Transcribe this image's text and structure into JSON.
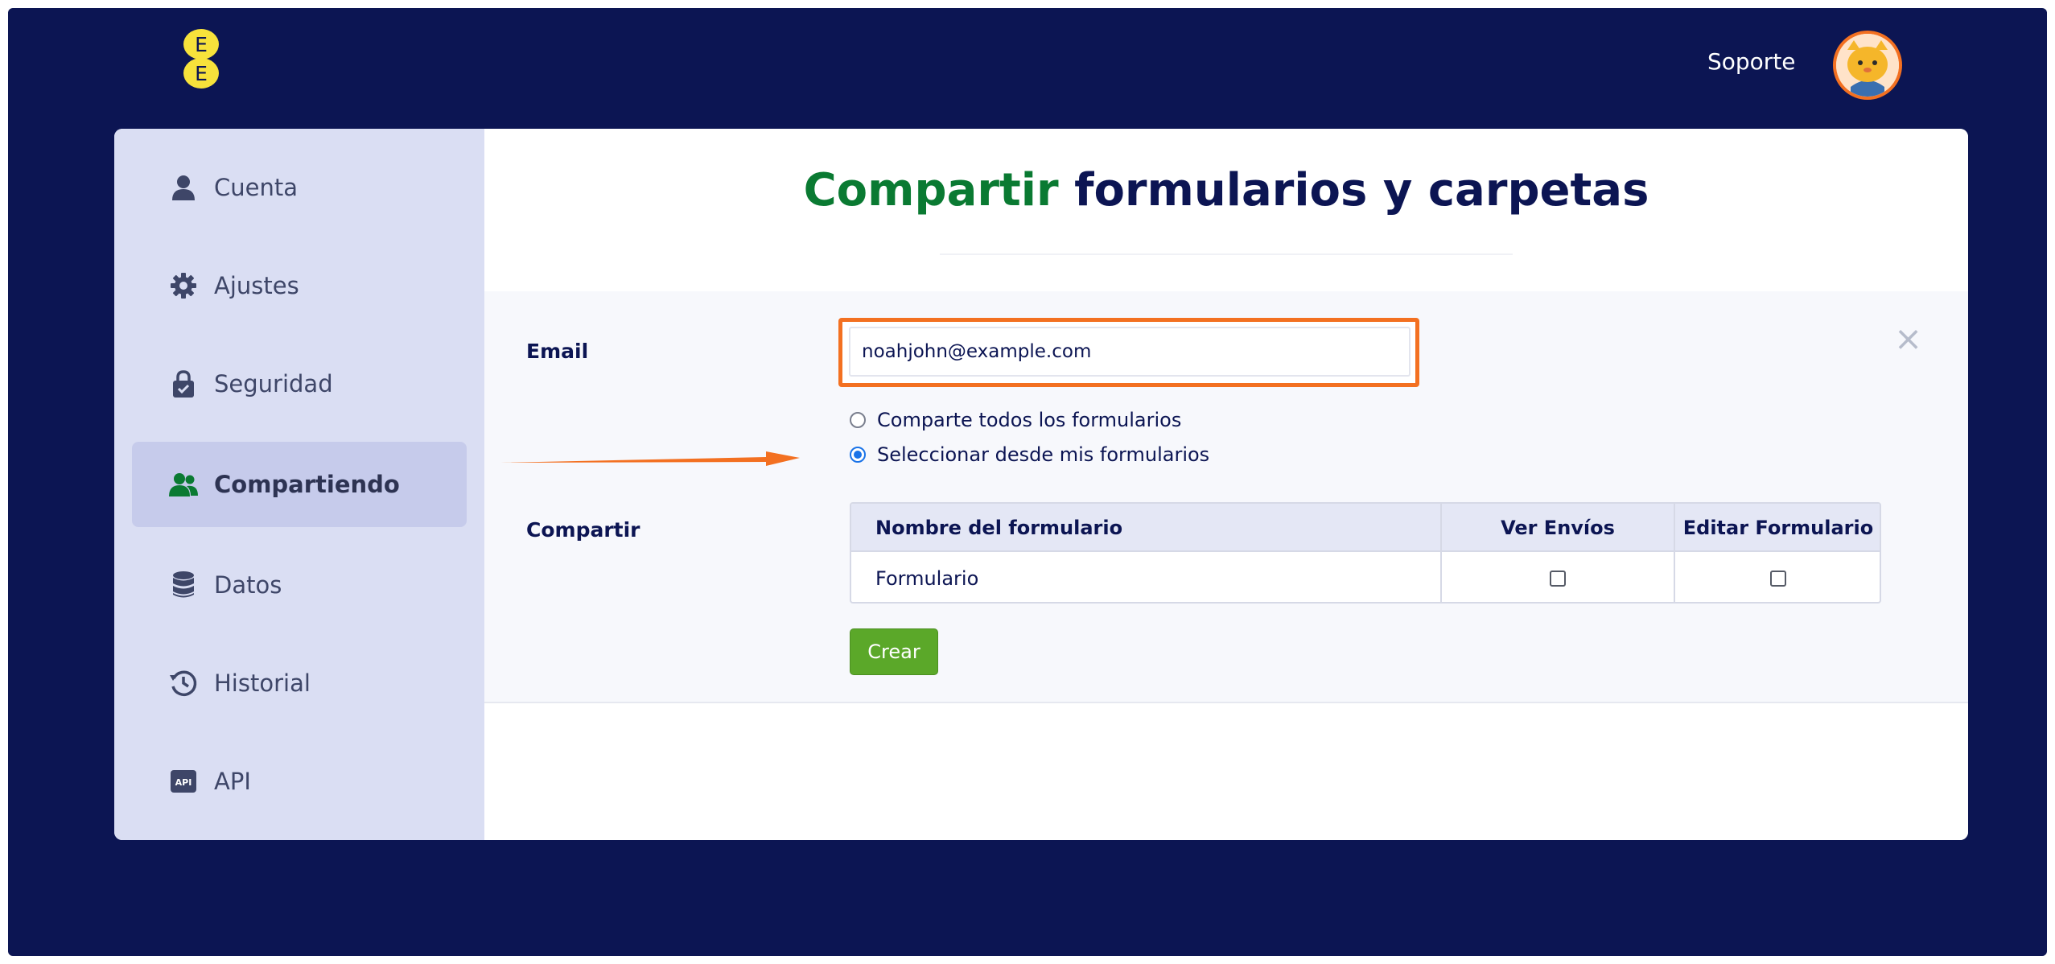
{
  "header": {
    "logo_letters": [
      "E",
      "E"
    ],
    "support_label": "Soporte",
    "avatar": "user-avatar-cat"
  },
  "sidebar": {
    "items": [
      {
        "label": "Cuenta",
        "icon": "user-icon",
        "active": false
      },
      {
        "label": "Ajustes",
        "icon": "gear-icon",
        "active": false
      },
      {
        "label": "Seguridad",
        "icon": "lock-icon",
        "active": false
      },
      {
        "label": "Compartiendo",
        "icon": "users-icon",
        "active": true
      },
      {
        "label": "Datos",
        "icon": "database-icon",
        "active": false
      },
      {
        "label": "Historial",
        "icon": "history-icon",
        "active": false
      },
      {
        "label": "API",
        "icon": "api-icon",
        "active": false
      }
    ]
  },
  "main": {
    "title_accent": "Compartir",
    "title_rest": " formularios y carpetas",
    "email_label": "Email",
    "email_value": "noahjohn@example.com",
    "radio_options": [
      {
        "label": "Comparte todos los formularios",
        "checked": false
      },
      {
        "label": "Seleccionar desde mis formularios",
        "checked": true
      }
    ],
    "share_label": "Compartir",
    "table": {
      "headers": [
        "Nombre del formulario",
        "Ver Envíos",
        "Editar Formulario"
      ],
      "rows": [
        {
          "name": "Formulario",
          "view_submissions": false,
          "edit_form": false
        }
      ]
    },
    "create_label": "Crear"
  },
  "colors": {
    "background": "#0c1553",
    "sidebar": "#dadef3",
    "accent_green": "#0a7a32",
    "highlight_orange": "#f37021",
    "button_green": "#5ba829"
  }
}
